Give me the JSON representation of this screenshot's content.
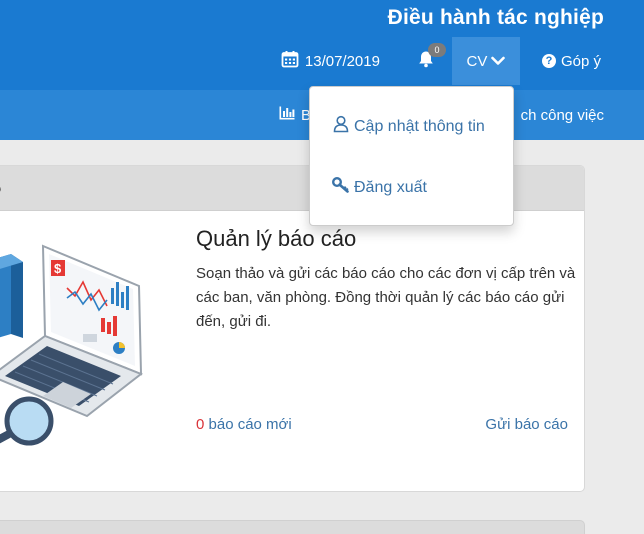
{
  "header": {
    "title": "Điều hành tác nghiệp",
    "date": "13/07/2019",
    "notification_count": "0",
    "user_menu_label": "CV",
    "feedback_label": "Góp ý"
  },
  "subnav": {
    "left_label": "B",
    "right_label": "ch công việc"
  },
  "user_menu": {
    "items": [
      {
        "label": "Cập nhật thông tin",
        "icon": "user-icon"
      },
      {
        "label": "Đăng xuất",
        "icon": "key-icon"
      }
    ]
  },
  "report_card": {
    "header": "cáo",
    "title": "Quản lý báo cáo",
    "description": "Soạn thảo và gửi các báo cáo cho các đơn vị cấp trên và các ban, văn phòng. Đồng thời quản lý các báo cáo gửi đến, gửi đi.",
    "new_count": "0",
    "new_label": "báo cáo mới",
    "send_label": "Gửi báo cáo"
  },
  "colors": {
    "header_bg": "#1a7ad1",
    "subnav_bg": "#2b86d6",
    "link": "#3a73a8",
    "count_red": "#d9343a"
  }
}
